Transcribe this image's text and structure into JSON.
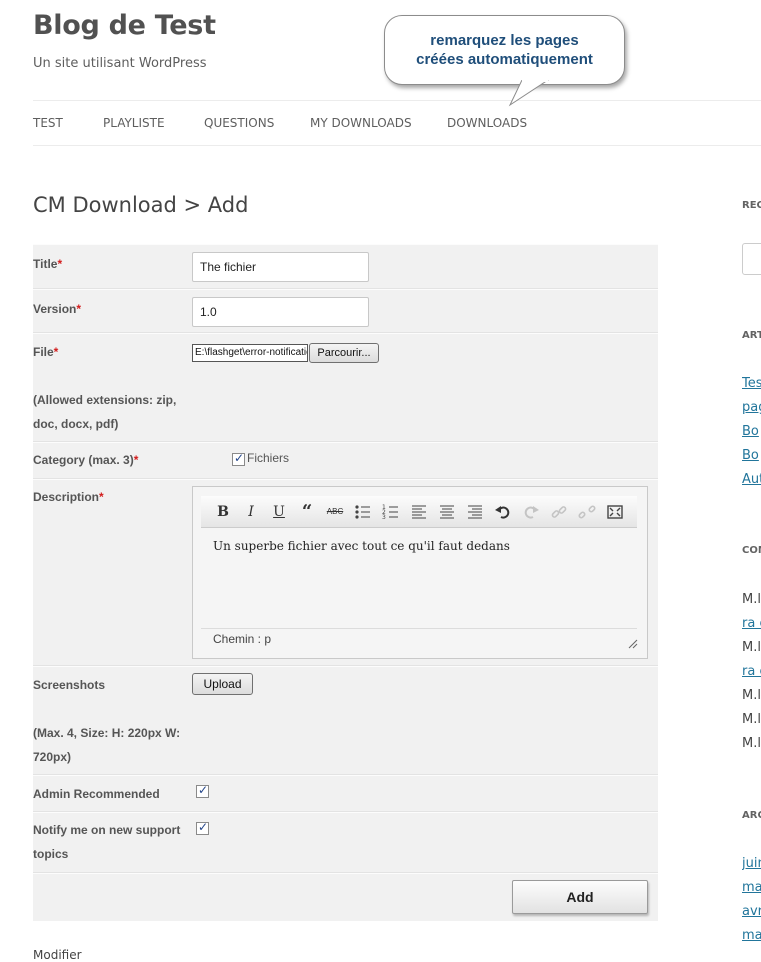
{
  "site": {
    "title": "Blog de Test",
    "description": "Un site utilisant WordPress"
  },
  "callout": {
    "line1": "remarquez les pages",
    "line2": "créées automatiquement"
  },
  "nav": [
    "TEST",
    "PLAYLISTE",
    "QUESTIONS",
    "MY DOWNLOADS",
    "DOWNLOADS"
  ],
  "page": {
    "title": "CM Download > Add"
  },
  "form": {
    "title_label": "Title",
    "title_value": "The fichier",
    "version_label": "Version",
    "version_value": "1.0",
    "file_label": "File",
    "file_value": "E:\\flashget\\error-notification",
    "browse_label": "Parcourir...",
    "file_note": "(Allowed extensions: zip, doc, docx, pdf)",
    "category_label": "Category (max. 3)",
    "category_option": "Fichiers",
    "description_label": "Description",
    "description_text": "Un superbe fichier avec tout ce qu'il faut dedans",
    "path_text": "Chemin : p",
    "screenshots_label": "Screenshots",
    "upload_label": "Upload",
    "screenshots_note": "(Max. 4, Size: H: 220px W: 720px)",
    "admin_label": "Admin Recommended",
    "notify_label": "Notify me on new support topics",
    "add_label": "Add",
    "required_mark": "*",
    "toolbar": {
      "bold": "B",
      "italic": "I",
      "underline": "U",
      "quote": "“",
      "strike": "ABC"
    }
  },
  "footer_text": "Modifier",
  "sidebar": {
    "headings": [
      "REC",
      "ART",
      "COM",
      "ARC"
    ],
    "articles": [
      "Tes",
      "pag",
      "Bo",
      "Bo",
      "Aut"
    ],
    "comments": [
      "M.l",
      "ra c",
      "M.l",
      "ra c",
      "M.l",
      "M.l",
      "M.l"
    ],
    "archives": [
      "juin",
      "ma",
      "avr",
      "ma"
    ]
  }
}
